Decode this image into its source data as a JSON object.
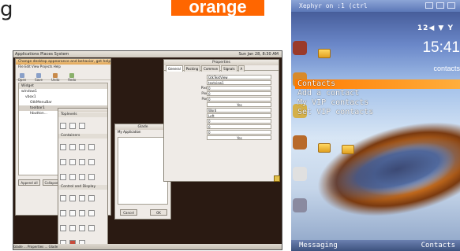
{
  "fragments": {
    "top_left_text": "g",
    "logo_text": "orange"
  },
  "desktop": {
    "panel_menu": "Applications  Places  System",
    "panel_clock": "Sun Jan 28, 8:30 AM",
    "bottom_panel": "Glade ... Properties ... Glade",
    "main_window": {
      "title": "Change desktop appearance and behavior, get help, or log out",
      "menu": "File  Edit  View  Projects  Help",
      "toolbar": [
        "Open",
        "Save",
        "Undo",
        "Redo"
      ],
      "tree_header": "Widget",
      "tree_items": [
        "window1",
        "vbox1",
        "GtkMenuBar",
        "toolbar1",
        "hbutton..."
      ],
      "buttons": [
        "Append all",
        "Collapse"
      ]
    },
    "palette": {
      "sections": [
        "Toplevels",
        "Containers",
        "Control and Display"
      ]
    },
    "dialog": {
      "title": "Glade",
      "label": "My Application",
      "buttons": [
        "Cancel",
        "OK"
      ]
    },
    "properties": {
      "title": "Properties",
      "tabs": [
        "General",
        "Packing",
        "Common",
        "Signals",
        "A"
      ],
      "rows": [
        {
          "key": "Class:",
          "value": "GtkTextView"
        },
        {
          "key": "Name:",
          "value": "textview1"
        },
        {
          "key": "Pixels Above Lines:",
          "value": "0"
        },
        {
          "key": "Pixels Below Lines:",
          "value": "0"
        },
        {
          "key": "Pixels Inside Wrap:",
          "value": "0"
        },
        {
          "key": "Editable:",
          "value": "Yes"
        },
        {
          "key": "Wrap Mode:",
          "value": "Word"
        },
        {
          "key": "Justification:",
          "value": "Left"
        },
        {
          "key": "Left Margin:",
          "value": "0"
        },
        {
          "key": "Right Margin:",
          "value": "0"
        },
        {
          "key": "Indent:",
          "value": "0"
        },
        {
          "key": "Cursor Visible:",
          "value": "Yes"
        }
      ]
    }
  },
  "phone": {
    "title": "Xephyr on :1 (ctrl",
    "status": "12◀ ▼ Y",
    "clock": "15:41",
    "clock_sub": "contacts",
    "menu_items": [
      "Contacts",
      "Add a contact",
      "My VIP contacts",
      "Set VIP contacts"
    ],
    "softkeys": {
      "left": "Messaging",
      "right": "Contacts"
    }
  },
  "colors": {
    "orange": "#ff6600",
    "phone_highlight": "#ff7a00",
    "desktop_bg": "#2a1a12"
  }
}
